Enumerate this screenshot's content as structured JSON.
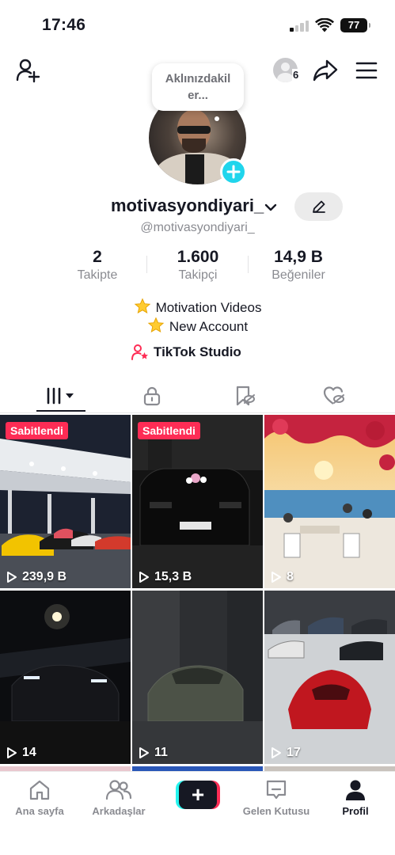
{
  "status_bar": {
    "time": "17:46",
    "battery": "77"
  },
  "header": {
    "viewers_count": "6"
  },
  "profile": {
    "bubble_text": "Aklınızdakiler...",
    "bubble_line1": "Aklınızdakil",
    "bubble_line2": "er...",
    "username": "motivasyondiyari_",
    "handle": "@motivasyondiyari_"
  },
  "stats": [
    {
      "value": "2",
      "label": "Takipte"
    },
    {
      "value": "1.600",
      "label": "Takipçi"
    },
    {
      "value": "14,9 B",
      "label": "Beğeniler"
    }
  ],
  "bio": {
    "line1": "Motivation Videos",
    "line2": "New Account",
    "studio_link": "TikTok Studio"
  },
  "videos": [
    {
      "pinned": "Sabitlendi",
      "views": "239,9 B"
    },
    {
      "pinned": "Sabitlendi",
      "views": "15,3 B"
    },
    {
      "pinned": "",
      "views": "8"
    },
    {
      "pinned": "",
      "views": "14"
    },
    {
      "pinned": "",
      "views": "11"
    },
    {
      "pinned": "",
      "views": "17"
    }
  ],
  "bottom_nav": {
    "home": "Ana sayfa",
    "friends": "Arkadaşlar",
    "inbox": "Gelen Kutusu",
    "profile": "Profil"
  },
  "colors": {
    "accent": "#fe2c55",
    "cyan": "#20d5ec",
    "text": "#161823",
    "muted": "#8a8b91"
  }
}
